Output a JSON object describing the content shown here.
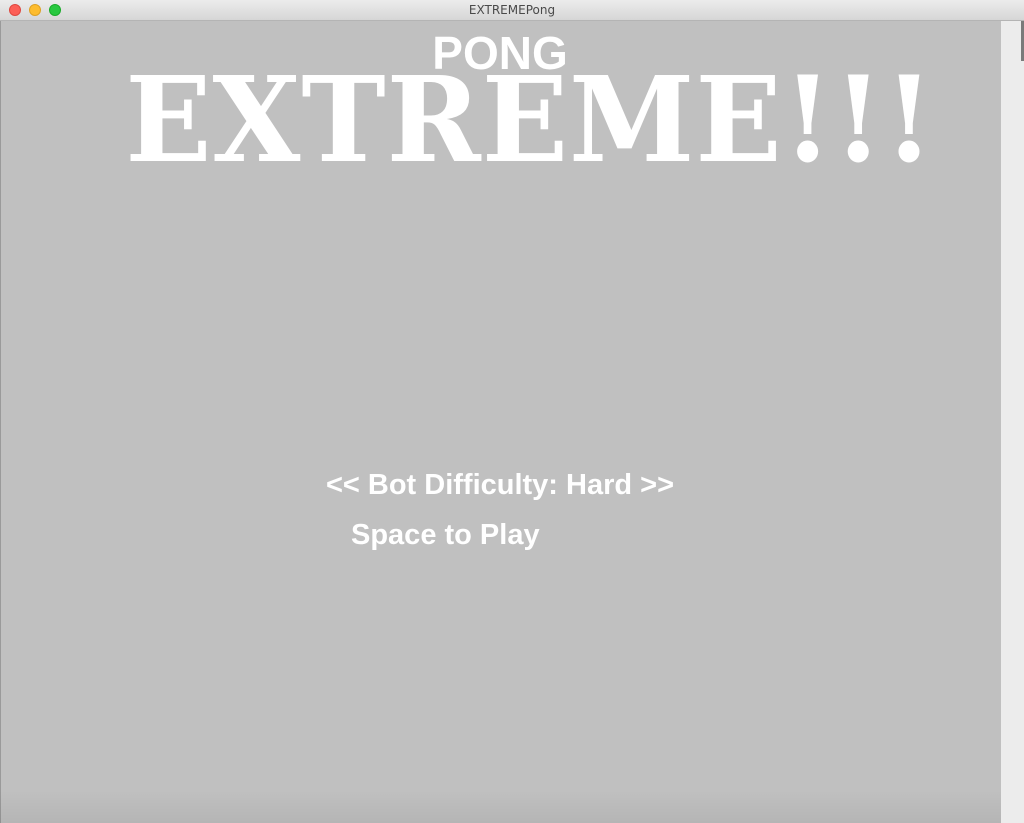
{
  "window": {
    "title": "EXTREMEPong"
  },
  "game": {
    "title_small": "PONG",
    "title_large": "EXTREME!!!",
    "difficulty_text": "<< Bot Difficulty: Hard >>",
    "play_prompt": "Space to Play",
    "background_color": "#c0c0c0",
    "text_color": "#ffffff"
  },
  "icons": {
    "close": "close-icon",
    "minimize": "minimize-icon",
    "zoom": "zoom-icon"
  }
}
